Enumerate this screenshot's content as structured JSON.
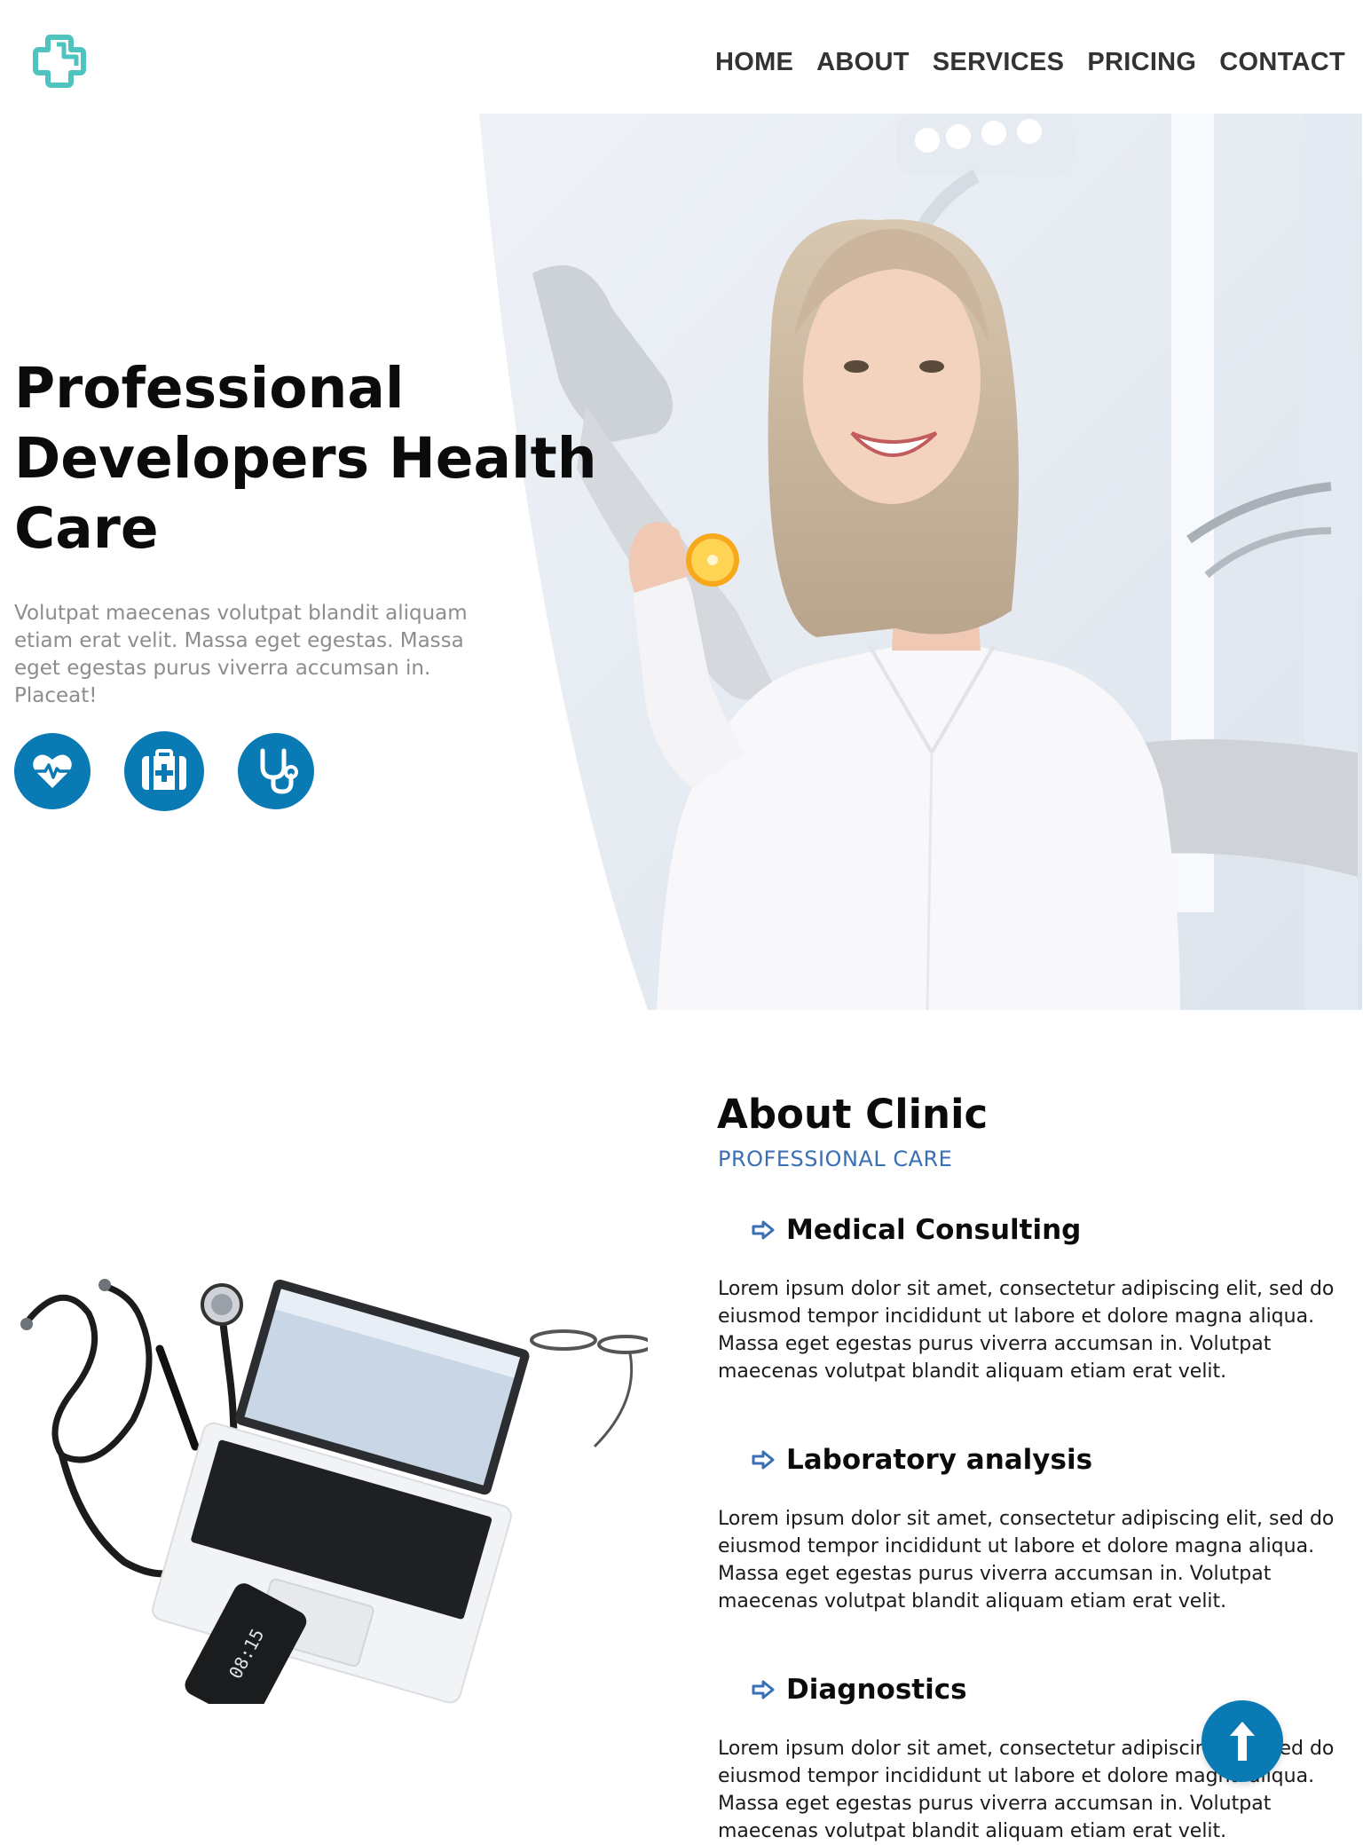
{
  "brand": {
    "logo_icon": "medical-cross-icon",
    "logo_color": "#4fc3c0"
  },
  "nav": {
    "items": [
      {
        "label": "HOME"
      },
      {
        "label": "ABOUT"
      },
      {
        "label": "SERVICES"
      },
      {
        "label": "PRICING"
      },
      {
        "label": "CONTACT"
      }
    ]
  },
  "hero": {
    "title": "Professional Developers Health Care",
    "text": "Volutpat maecenas volutpat blandit aliquam etiam erat velit. Massa eget egestas. Massa eget egestas purus viverra accumsan in. Placeat!",
    "image": "woman-doctor-holding-orange-photo",
    "buttons": [
      {
        "icon": "heartbeat-icon"
      },
      {
        "icon": "first-aid-kit-icon"
      },
      {
        "icon": "stethoscope-icon"
      }
    ],
    "accent_color": "#0a7ab4"
  },
  "about": {
    "title": "About Clinic",
    "subtitle": "PROFESSIONAL CARE",
    "image": "stethoscope-laptop-desk-photo",
    "services": [
      {
        "title": "Medical Consulting",
        "text": "Lorem ipsum dolor sit amet, consectetur adipiscing elit, sed do eiusmod tempor incididunt ut labore et dolore magna aliqua. Massa eget egestas purus viverra accumsan in. Volutpat maecenas volutpat blandit aliquam etiam erat velit."
      },
      {
        "title": "Laboratory analysis",
        "text": "Lorem ipsum dolor sit amet, consectetur adipiscing elit, sed do eiusmod tempor incididunt ut labore et dolore magna aliqua. Massa eget egestas purus viverra accumsan in. Volutpat maecenas volutpat blandit aliquam etiam erat velit."
      },
      {
        "title": "Diagnostics",
        "text": "Lorem ipsum dolor sit amet, consectetur adipiscing elit, sed do eiusmod tempor incididunt ut labore et dolore magna aliqua. Massa eget egestas purus viverra accumsan in. Volutpat maecenas volutpat blandit aliquam etiam erat velit."
      }
    ]
  },
  "back_to_top": {
    "icon": "arrow-up-icon"
  }
}
